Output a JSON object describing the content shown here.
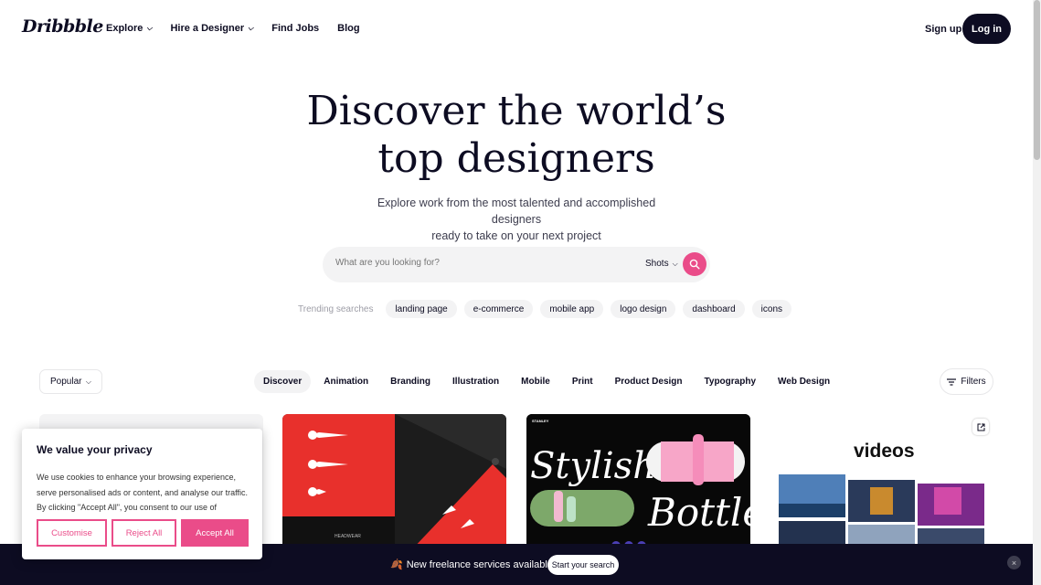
{
  "header": {
    "logo": "Dribbble",
    "nav": [
      {
        "label": "Explore",
        "has_dropdown": true
      },
      {
        "label": "Hire a Designer",
        "has_dropdown": true
      },
      {
        "label": "Find Jobs",
        "has_dropdown": false
      },
      {
        "label": "Blog",
        "has_dropdown": false
      }
    ],
    "signup": "Sign up",
    "login": "Log in"
  },
  "hero": {
    "title_line1": "Discover the world’s",
    "title_line2": "top designers",
    "subtitle_line1": "Explore work from the most talented and accomplished designers",
    "subtitle_line2": "ready to take on your next project"
  },
  "search": {
    "placeholder": "What are you looking for?",
    "type_selected": "Shots"
  },
  "trending": {
    "label": "Trending searches",
    "items": [
      "landing page",
      "e-commerce",
      "mobile app",
      "logo design",
      "dashboard",
      "icons"
    ]
  },
  "filters": {
    "sort": "Popular",
    "categories": [
      "Discover",
      "Animation",
      "Branding",
      "Illustration",
      "Mobile",
      "Print",
      "Product Design",
      "Typography",
      "Web Design"
    ],
    "active_category": "Discover",
    "filters_label": "Filters"
  },
  "shots": {
    "card2_caption": "HEADWEAR",
    "card3_brand": "STANLEY",
    "card3_word1": "Stylish",
    "card3_word2": "Bottle",
    "card4_title": "videos"
  },
  "cookie": {
    "title": "We value your privacy",
    "body": "We use cookies to enhance your browsing experience, serve personalised ads or content, and analyse our traffic. By clicking \"Accept All\", you consent to our use of cookies.",
    "customise": "Customise",
    "reject": "Reject All",
    "accept": "Accept All"
  },
  "banner": {
    "emoji": "🍂",
    "text": "New freelance services available!",
    "cta": "Start your search",
    "close": "×"
  },
  "colors": {
    "brand_pink": "#ea4c89",
    "dark": "#0d0c22"
  }
}
